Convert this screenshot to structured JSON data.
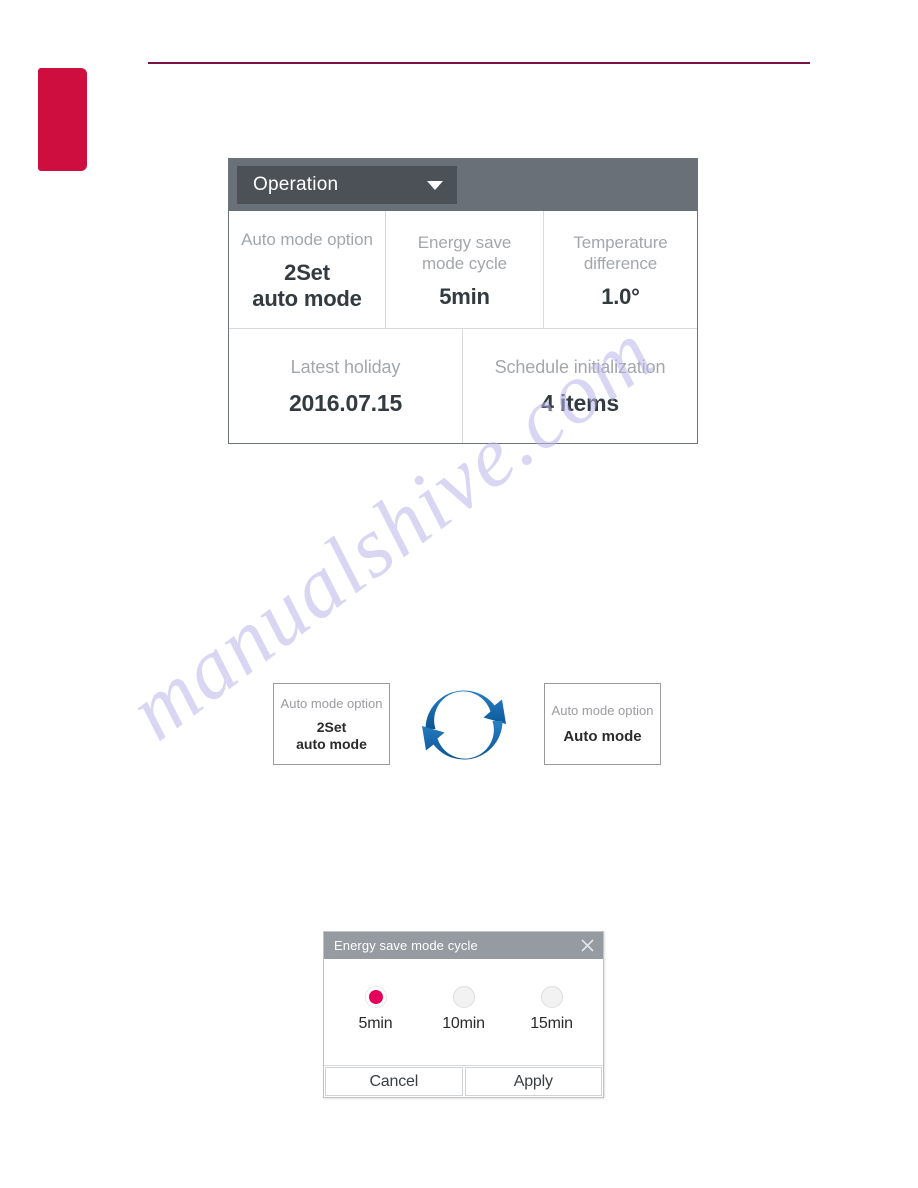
{
  "page": {
    "background_color": "#ffffff",
    "accent_rule_color": "#7c1347",
    "side_tab_color": "#ce0e3e",
    "watermark_text": "manualshive.com"
  },
  "device_panel": {
    "header": {
      "dropdown_label": "Operation",
      "caret_icon": "chevron-down-icon",
      "header_bg": "#6a7077",
      "dropdown_bg": "#4c5158"
    },
    "rows": [
      {
        "cells": [
          {
            "label": "Auto mode option",
            "value": "2Set\nauto mode"
          },
          {
            "label": "Energy save\nmode cycle",
            "value": "5min"
          },
          {
            "label": "Temperature\ndifference",
            "value": "1.0°"
          }
        ]
      },
      {
        "cells": [
          {
            "label": "Latest holiday",
            "value": "2016.07.15"
          },
          {
            "label": "Schedule initialization",
            "value": "4 items"
          }
        ]
      }
    ]
  },
  "cycle_diagram": {
    "icon": "cycle-arrows-icon",
    "arrow_color": "#1b6fb5",
    "left_box": {
      "label": "Auto mode option",
      "value": "2Set\nauto mode"
    },
    "right_box": {
      "label": "Auto mode option",
      "value": "Auto mode"
    }
  },
  "dialog": {
    "title": "Energy save mode cycle",
    "close_icon": "close-icon",
    "titlebar_color": "#959ba1",
    "selected_color": "#e4005a",
    "selected_index": 0,
    "options": [
      {
        "label": "5min",
        "selected": true
      },
      {
        "label": "10min",
        "selected": false
      },
      {
        "label": "15min",
        "selected": false
      }
    ],
    "buttons": {
      "cancel": "Cancel",
      "apply": "Apply"
    }
  }
}
